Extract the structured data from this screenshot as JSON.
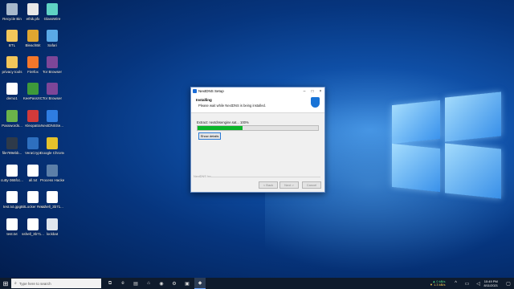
{
  "desktop_icons": [
    {
      "label": "Recycle Bin",
      "icon": "recycle-bin-icon",
      "color": "#a8b9cc"
    },
    {
      "label": "ethik.pfx",
      "icon": "certificate-icon",
      "color": "#e8e8e8"
    },
    {
      "label": "GlassWire",
      "icon": "glasswire-icon",
      "color": "#5fd3c4"
    },
    {
      "label": "BTL",
      "icon": "folder-icon",
      "color": "#f3c65a"
    },
    {
      "label": "BleachBit",
      "icon": "bleachbit-icon",
      "color": "#e0a630"
    },
    {
      "label": "Safari",
      "icon": "safari-icon",
      "color": "#5aa9e6"
    },
    {
      "label": "privacy tools",
      "icon": "folder-icon",
      "color": "#f3c65a"
    },
    {
      "label": "Firefox",
      "icon": "firefox-icon",
      "color": "#f5772a"
    },
    {
      "label": "Tor Browser",
      "icon": "tor-browser-icon",
      "color": "#7d4698"
    },
    {
      "label": "demo1",
      "icon": "document-icon",
      "color": "#ffffff"
    },
    {
      "label": "KeePassXC",
      "icon": "keepassxc-icon",
      "color": "#3e9a3a"
    },
    {
      "label": "Tor Browser",
      "icon": "tor-browser-icon",
      "color": "#7d4698"
    },
    {
      "label": "Passwords...",
      "icon": "passwords-icon",
      "color": "#6bb34a"
    },
    {
      "label": "Kleopatra",
      "icon": "kleopatra-icon",
      "color": "#d23a3a"
    },
    {
      "label": "NextDNSSe...",
      "icon": "nextdns-icon",
      "color": "#2f7de1"
    },
    {
      "label": "file789ebb...",
      "icon": "file-icon",
      "color": "#2e3a4a"
    },
    {
      "label": "VeraCrypt",
      "icon": "veracrypt-icon",
      "color": "#2e6fbf"
    },
    {
      "label": "Google Chrome",
      "icon": "chrome-icon",
      "color": "#e5c22b"
    },
    {
      "label": "cutty-365fcc...",
      "icon": "document-icon",
      "color": "#ffffff"
    },
    {
      "label": "all.txt",
      "icon": "text-file-icon",
      "color": "#ffffff"
    },
    {
      "label": "Process Hacker 2",
      "icon": "process-hacker-icon",
      "color": "#5c7fa8"
    },
    {
      "label": "test.txt.gpg",
      "icon": "gpg-file-icon",
      "color": "#ffffff"
    },
    {
      "label": "BitLocker Recovery K...",
      "icon": "text-file-icon",
      "color": "#ffffff"
    },
    {
      "label": "sshell_3b71...",
      "icon": "gpg-file-icon",
      "color": "#ffffff"
    },
    {
      "label": "test.txt",
      "icon": "text-file-icon",
      "color": "#ffffff"
    },
    {
      "label": "sshell_3b71...",
      "icon": "document-icon",
      "color": "#ffffff"
    },
    {
      "label": "lockbat",
      "icon": "batch-file-icon",
      "color": "#e0e6ee"
    }
  ],
  "dialog": {
    "title": "NextDNS Setup",
    "heading": "Installing",
    "subheading": "Please wait while NextDNS is being installed.",
    "extract_text": "Extract: nextdnsengine.sat...  100%",
    "progress": 0.37,
    "show_details": "Show details",
    "footer_label": "NextDNS Inc",
    "back": "< Back",
    "next": "Next >",
    "cancel": "Cancel"
  },
  "taskbar": {
    "search_placeholder": "Type here to search",
    "apps": [
      "task-view-icon",
      "edge-icon",
      "file-explorer-icon",
      "store-icon",
      "firefox-icon",
      "settings-icon",
      "photos-icon",
      "nextdns-setup-icon"
    ],
    "net_up": "▲ 0 kB/s",
    "net_down": "▼ 1.3 kB/s",
    "time": "10:49 PM",
    "date": "8/11/2021"
  }
}
